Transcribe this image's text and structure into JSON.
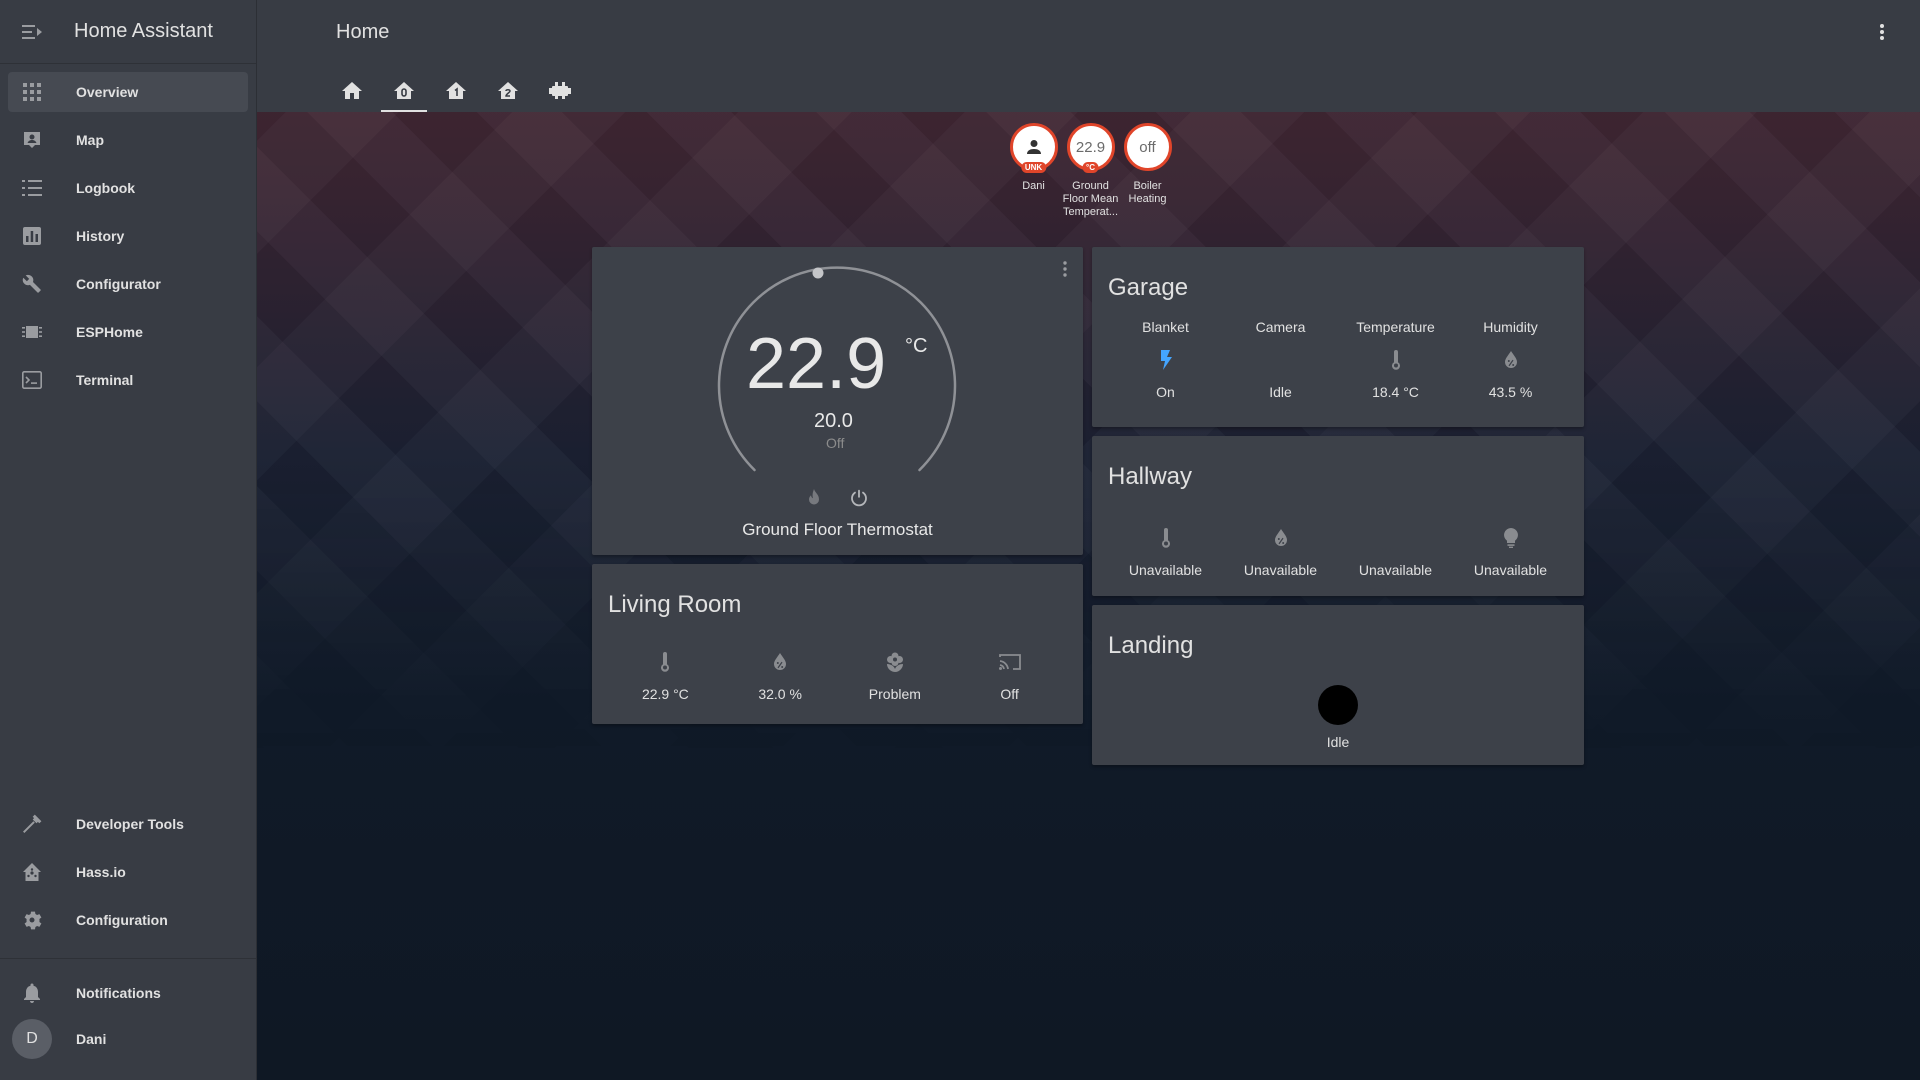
{
  "app": {
    "title": "Home Assistant"
  },
  "sidebar": {
    "items": [
      {
        "label": "Overview",
        "icon": "grid-icon",
        "active": true
      },
      {
        "label": "Map",
        "icon": "map-icon"
      },
      {
        "label": "Logbook",
        "icon": "list-icon"
      },
      {
        "label": "History",
        "icon": "chart-icon"
      },
      {
        "label": "Configurator",
        "icon": "wrench-icon"
      },
      {
        "label": "ESPHome",
        "icon": "chip-icon"
      },
      {
        "label": "Terminal",
        "icon": "terminal-icon"
      }
    ],
    "bottom_items": [
      {
        "label": "Developer Tools",
        "icon": "hammer-icon"
      },
      {
        "label": "Hass.io",
        "icon": "home-assistant-icon"
      },
      {
        "label": "Configuration",
        "icon": "gear-icon"
      }
    ],
    "notifications_label": "Notifications",
    "user": {
      "initial": "D",
      "name": "Dani"
    }
  },
  "header": {
    "title": "Home"
  },
  "tabs": [
    "home-icon",
    "home-floor-0-icon",
    "home-floor-1-icon",
    "home-floor-2-icon",
    "factory-icon"
  ],
  "badges": [
    {
      "label": "Dani",
      "value": "",
      "tag": "UNK",
      "icon": "account-icon"
    },
    {
      "label": "Ground Floor Mean Temperat...",
      "value": "22.9",
      "tag": "°C"
    },
    {
      "label": "Boiler Heating",
      "value": "off",
      "tag": ""
    }
  ],
  "thermostat": {
    "current": "22.9",
    "unit": "°C",
    "target": "20.0",
    "mode": "Off",
    "name": "Ground Floor Thermostat"
  },
  "garage": {
    "title": "Garage",
    "entities": [
      {
        "name": "Blanket",
        "state": "On",
        "icon": "flash-icon",
        "color": "#44a5ff"
      },
      {
        "name": "Camera",
        "state": "Idle",
        "icon": ""
      },
      {
        "name": "Temperature",
        "state": "18.4 °C",
        "icon": "thermometer-icon"
      },
      {
        "name": "Humidity",
        "state": "43.5 %",
        "icon": "water-percent-icon"
      }
    ]
  },
  "hallway": {
    "title": "Hallway",
    "entities": [
      {
        "state": "Unavailable",
        "icon": "thermometer-icon"
      },
      {
        "state": "Unavailable",
        "icon": "water-percent-icon"
      },
      {
        "state": "Unavailable",
        "icon": ""
      },
      {
        "state": "Unavailable",
        "icon": "lightbulb-icon"
      }
    ]
  },
  "living_room": {
    "title": "Living Room",
    "entities": [
      {
        "state": "22.9 °C",
        "icon": "thermometer-icon"
      },
      {
        "state": "32.0 %",
        "icon": "water-percent-icon"
      },
      {
        "state": "Problem",
        "icon": "flower-icon"
      },
      {
        "state": "Off",
        "icon": "cast-icon"
      }
    ]
  },
  "landing": {
    "title": "Landing",
    "state": "Idle"
  },
  "colors": {
    "accent": "#e0452a",
    "sidebar_bg": "#383c44",
    "card_bg": "#3d4149",
    "blanket_on": "#44a5ff"
  }
}
